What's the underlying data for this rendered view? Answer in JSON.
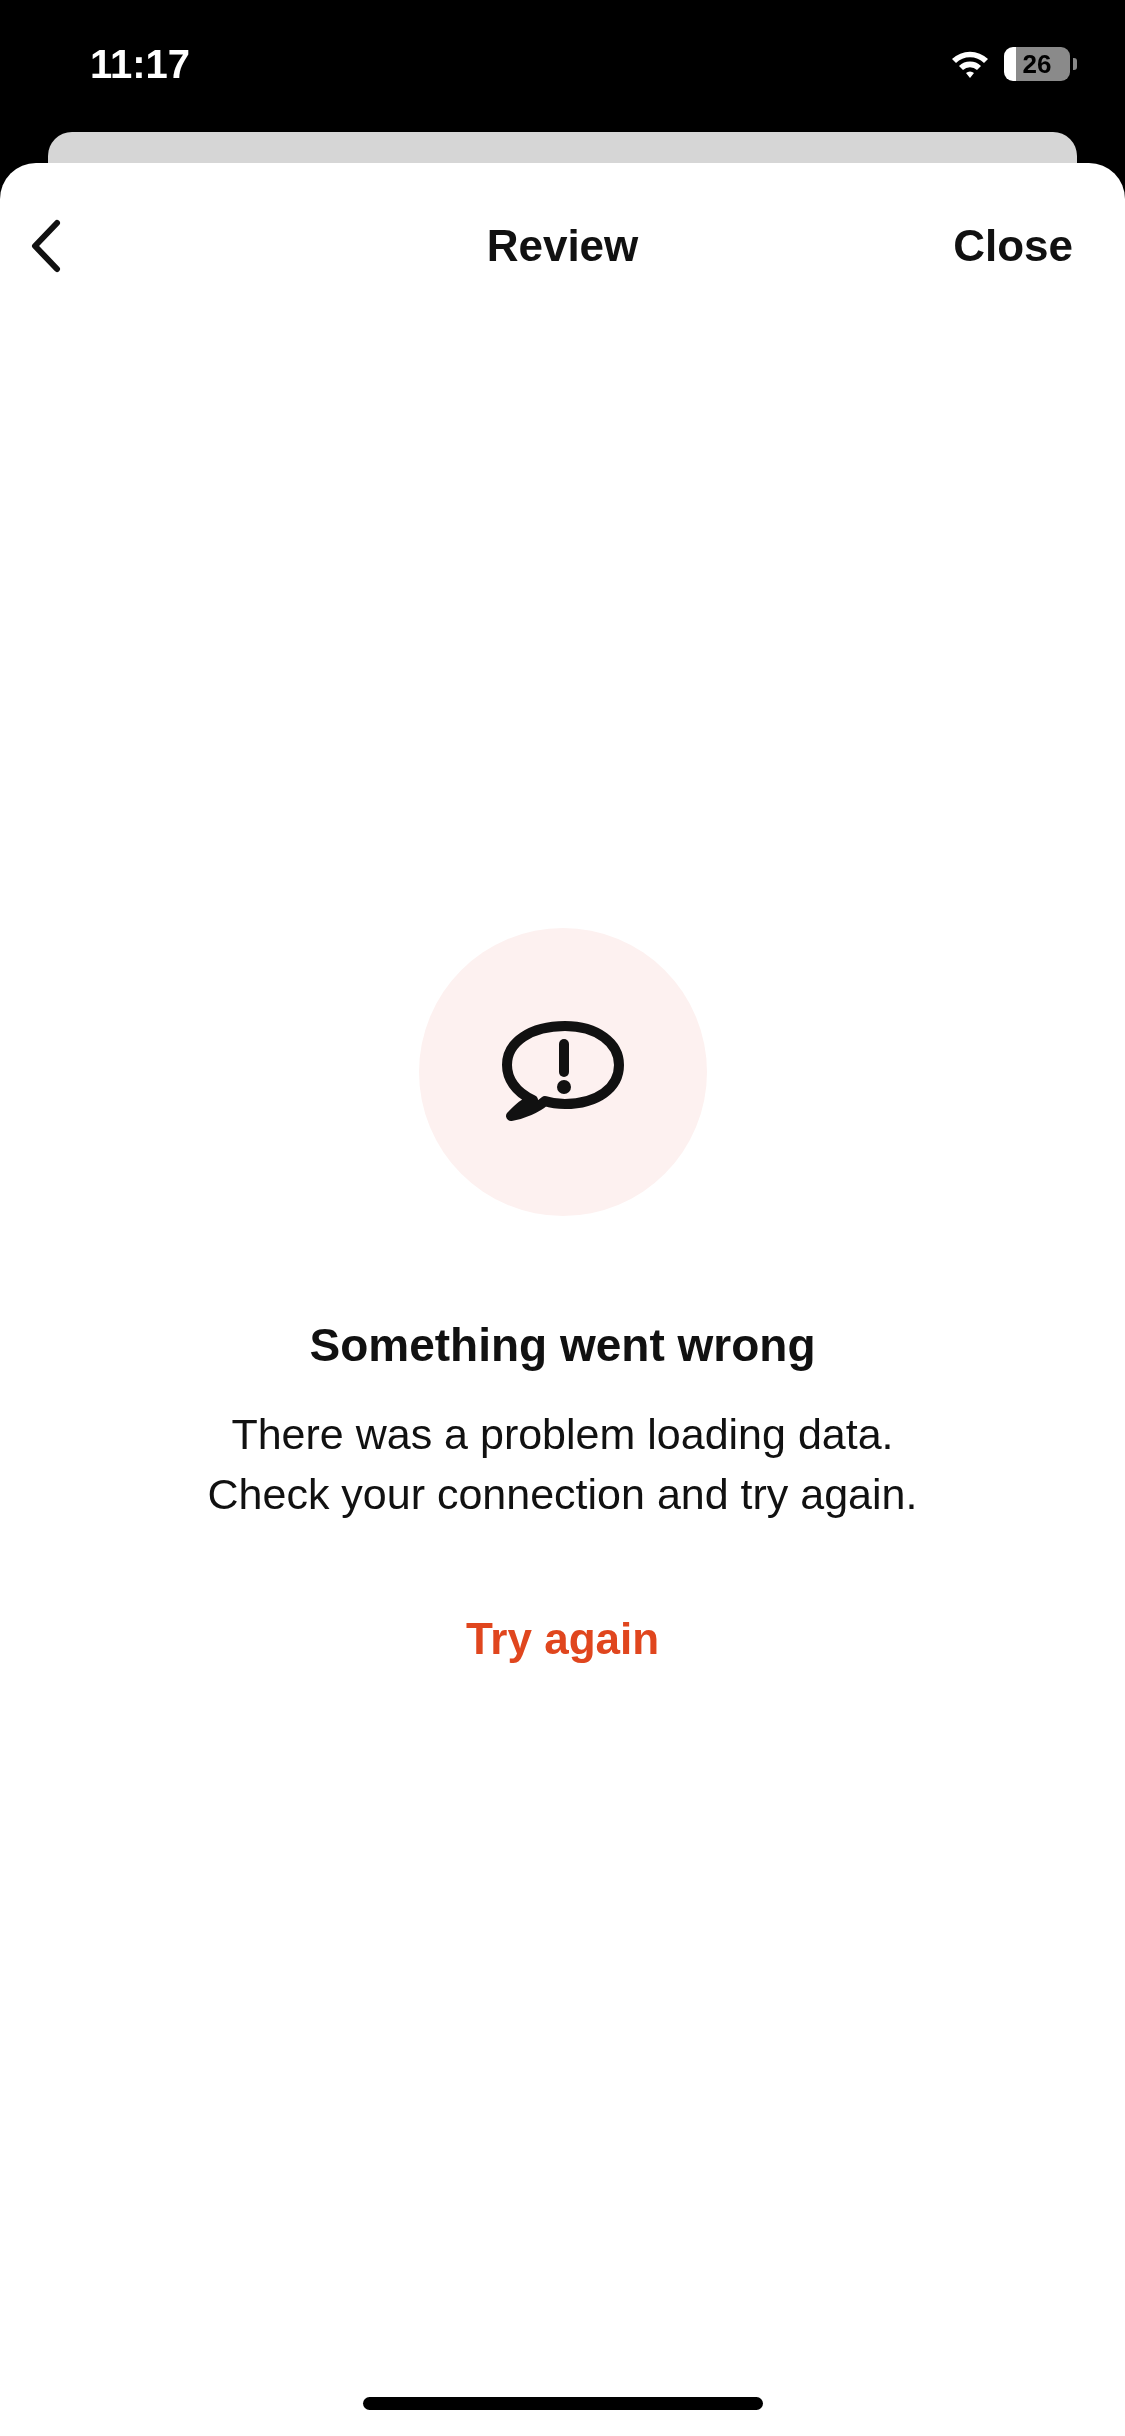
{
  "status_bar": {
    "time": "11:17",
    "battery": "26"
  },
  "header": {
    "title": "Review",
    "close": "Close"
  },
  "error": {
    "title": "Something went wrong",
    "message": "There was a problem loading data.\nCheck your connection and try again.",
    "action": "Try again"
  }
}
